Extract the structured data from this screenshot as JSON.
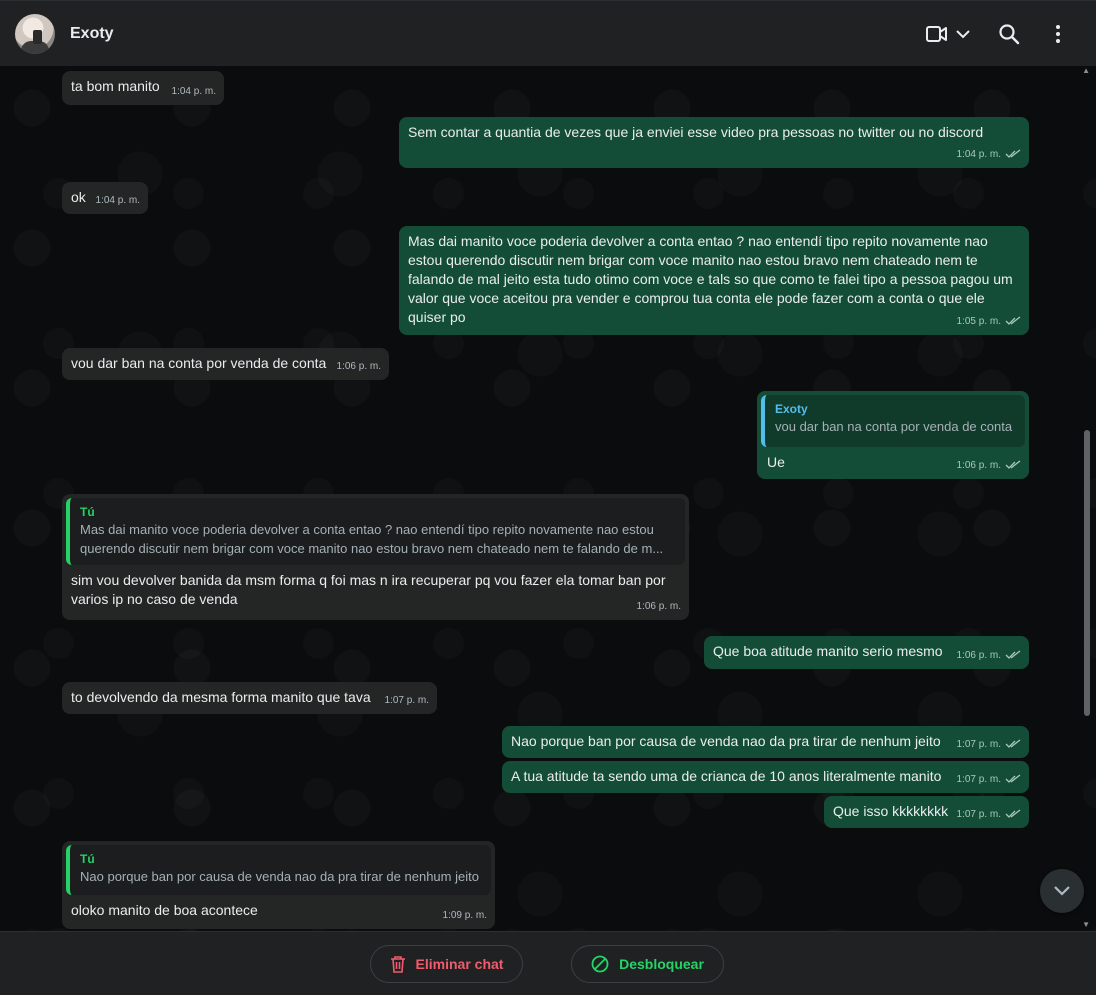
{
  "header": {
    "contact_name": "Exoty",
    "icons": [
      "avatar",
      "video-call-icon",
      "chevron-down-icon",
      "search-icon",
      "menu-dots-icon"
    ]
  },
  "messages": [
    {
      "dir": "in",
      "text": "ta bom manito",
      "time": "1:04 p. m."
    },
    {
      "dir": "out",
      "text": "Sem contar a quantia de vezes que ja enviei esse video pra pessoas no twitter ou no discord",
      "time": "1:04 p. m."
    },
    {
      "dir": "in",
      "text": "ok",
      "time": "1:04 p. m."
    },
    {
      "dir": "out",
      "text": "Mas dai manito voce poderia devolver a conta entao ? nao entendí tipo repito novamente nao estou querendo discutir nem brigar com voce manito nao estou bravo nem chateado nem te falando de mal jeito esta tudo otimo com voce e tals so que como te falei tipo a pessoa pagou um valor que voce aceitou pra vender e comprou tua conta ele pode fazer com a conta o que ele quiser po",
      "time": "1:05 p. m."
    },
    {
      "dir": "in",
      "text": "vou dar ban na conta por venda de conta",
      "time": "1:06 p. m."
    },
    {
      "dir": "out",
      "quote_author": "Exoty",
      "quote_text": "vou dar ban na conta por venda de conta",
      "text": "Ue",
      "time": "1:06 p. m."
    },
    {
      "dir": "in",
      "quote_author": "Tú",
      "quote_text": "Mas dai manito voce poderia devolver a conta entao ? nao entendí tipo repito novamente nao estou querendo discutir nem brigar com voce manito nao estou bravo nem chateado nem te falando de m...",
      "text": "sim vou devolver banida da msm forma q foi mas n ira recuperar pq vou fazer ela tomar ban por varios ip no caso de venda",
      "time": "1:06 p. m."
    },
    {
      "dir": "out",
      "text": "Que boa atitude manito serio mesmo",
      "time": "1:06 p. m."
    },
    {
      "dir": "in",
      "text": "to devolvendo da mesma forma manito que tava",
      "time": "1:07 p. m."
    },
    {
      "dir": "out",
      "text": "Nao porque ban por causa de venda nao da pra tirar de nenhum jeito",
      "time": "1:07 p. m."
    },
    {
      "dir": "out",
      "text": "A tua atitude ta sendo uma de crianca de 10 anos literalmente manito",
      "time": "1:07 p. m."
    },
    {
      "dir": "out",
      "text": "Que isso kkkkkkkk",
      "time": "1:07 p. m."
    },
    {
      "dir": "in",
      "quote_author": "Tú",
      "quote_text": "Nao porque ban por causa de venda nao da pra tirar de nenhum jeito",
      "text": "oloko manito de boa acontece",
      "time": "1:09 p. m."
    }
  ],
  "footer": {
    "delete_label": "Eliminar chat",
    "unblock_label": "Desbloquear"
  },
  "colors": {
    "outgoing_bubble": "#144d37",
    "incoming_bubble": "#242626",
    "delete_red": "#f15c6d",
    "unblock_green": "#25d366",
    "quote_green": "#25d366",
    "quote_blue": "#53bdeb"
  }
}
